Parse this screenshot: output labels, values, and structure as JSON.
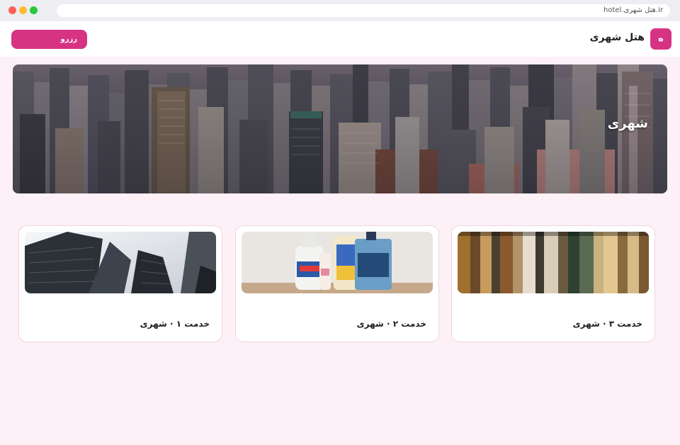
{
  "browser": {
    "url": "hotel.هتل شهری.ir"
  },
  "header": {
    "logo_text": "ه",
    "brand": "هتل شهری",
    "reserve_label": "رزرو"
  },
  "hero": {
    "title": "شهری"
  },
  "cards": [
    {
      "title": "خدمت ۳ · شهری"
    },
    {
      "title": "خدمت ۲ · شهری"
    },
    {
      "title": "خدمت ۱ · شهری"
    }
  ],
  "colors": {
    "accent": "#d63384",
    "page_bg": "#fdf0f6"
  }
}
